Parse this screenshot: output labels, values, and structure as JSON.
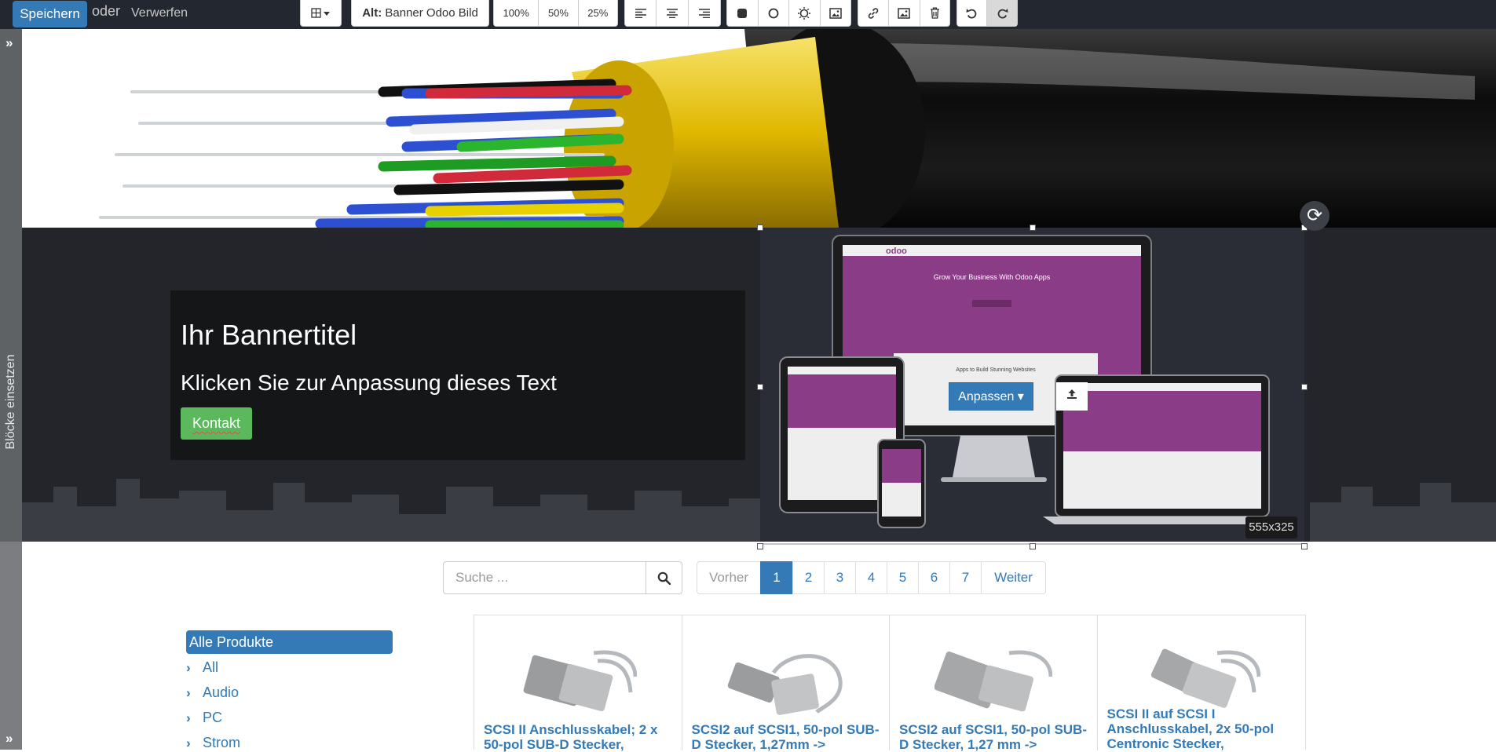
{
  "toolbar": {
    "save_label": "Speichern",
    "or_label": "oder",
    "discard_label": "Verwerfen",
    "alt_prefix": "Alt:",
    "alt_value": "Banner Odoo Bild",
    "size_options": [
      "100%",
      "50%",
      "25%"
    ]
  },
  "sidebar": {
    "insert_blocks_label": "Blöcke einsetzen"
  },
  "banner": {
    "title": "Ihr Bannertitel",
    "subtitle": "Klicken Sie zur Anpassung dieses Text",
    "button_label": "Kontakt",
    "customize_label": "Anpassen",
    "image_size": "555x325",
    "screen_headline": "Grow Your Business With Odoo Apps",
    "screen_tagline": "Apps to Build Stunning Websites",
    "screen_logo": "odoo"
  },
  "search": {
    "placeholder": "Suche ..."
  },
  "pager": {
    "prev_label": "Vorher",
    "pages": [
      "1",
      "2",
      "3",
      "4",
      "5",
      "6",
      "7"
    ],
    "active_page": "1",
    "next_label": "Weiter"
  },
  "categories": {
    "active": "Alle Produkte",
    "items": [
      "All",
      "Audio",
      "PC",
      "Strom"
    ]
  },
  "products": [
    {
      "name": "SCSI II Anschlusskabel; 2 x 50-pol SUB-D Stecker,"
    },
    {
      "name": "SCSI2 auf SCSI1, 50-pol SUB-D Stecker, 1,27mm ->"
    },
    {
      "name": "SCSI2 auf SCSI1, 50-pol SUB-D Stecker, 1,27 mm ->"
    },
    {
      "name": "SCSI II auf SCSI I Anschlusskabel, 2x 50-pol Centronic Stecker,"
    }
  ],
  "colors": {
    "primary": "#337ab7",
    "success": "#5cb85c",
    "toolbar_bg": "#23272f",
    "banner_bg": "#23252b"
  }
}
